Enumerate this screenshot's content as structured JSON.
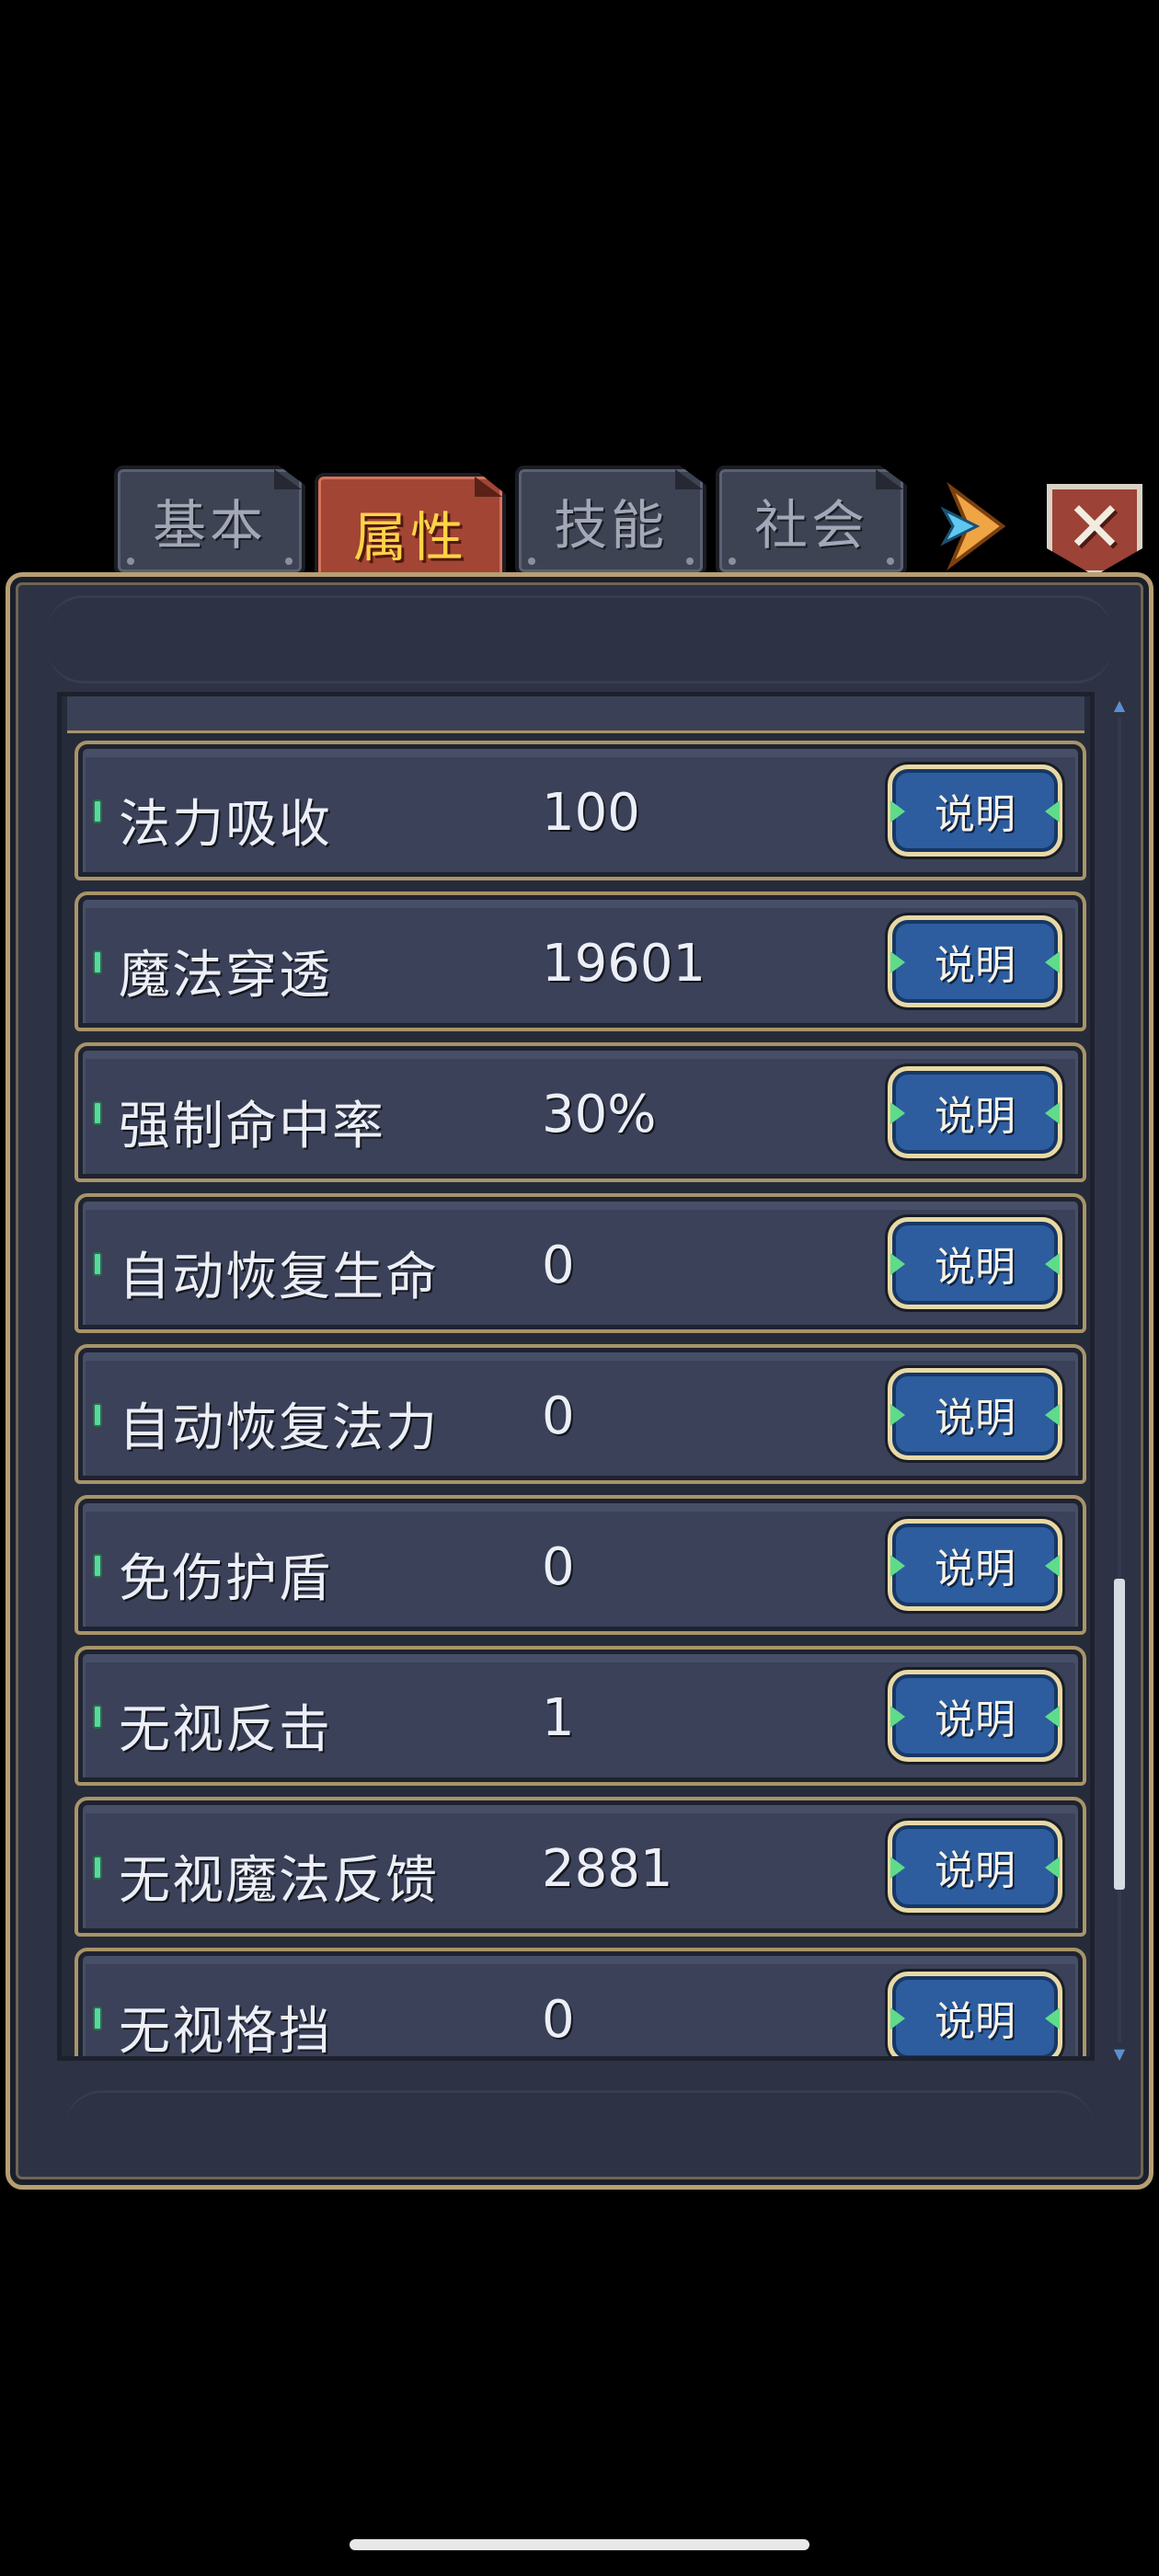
{
  "tabs": [
    {
      "label": "基本",
      "active": false
    },
    {
      "label": "属性",
      "active": true
    },
    {
      "label": "技能",
      "active": false
    },
    {
      "label": "社会",
      "active": false
    }
  ],
  "icons": {
    "arrow": "arrow-right-icon",
    "close": "close-icon"
  },
  "close_label": "✕",
  "attributes": [
    {
      "name": "法力吸收",
      "value": "100",
      "button": "说明"
    },
    {
      "name": "魔法穿透",
      "value": "19601",
      "button": "说明"
    },
    {
      "name": "强制命中率",
      "value": "30%",
      "button": "说明"
    },
    {
      "name": "自动恢复生命",
      "value": "0",
      "button": "说明"
    },
    {
      "name": "自动恢复法力",
      "value": "0",
      "button": "说明"
    },
    {
      "name": "免伤护盾",
      "value": "0",
      "button": "说明"
    },
    {
      "name": "无视反击",
      "value": "1",
      "button": "说明"
    },
    {
      "name": "无视魔法反馈",
      "value": "2881",
      "button": "说明"
    },
    {
      "name": "无视格挡",
      "value": "0",
      "button": "说明"
    }
  ],
  "colors": {
    "active_tab": "#a24534",
    "active_tab_text": "#ffd347",
    "panel": "#2d3345",
    "button": "#2d5d9e",
    "border_gold": "#b79f72"
  }
}
